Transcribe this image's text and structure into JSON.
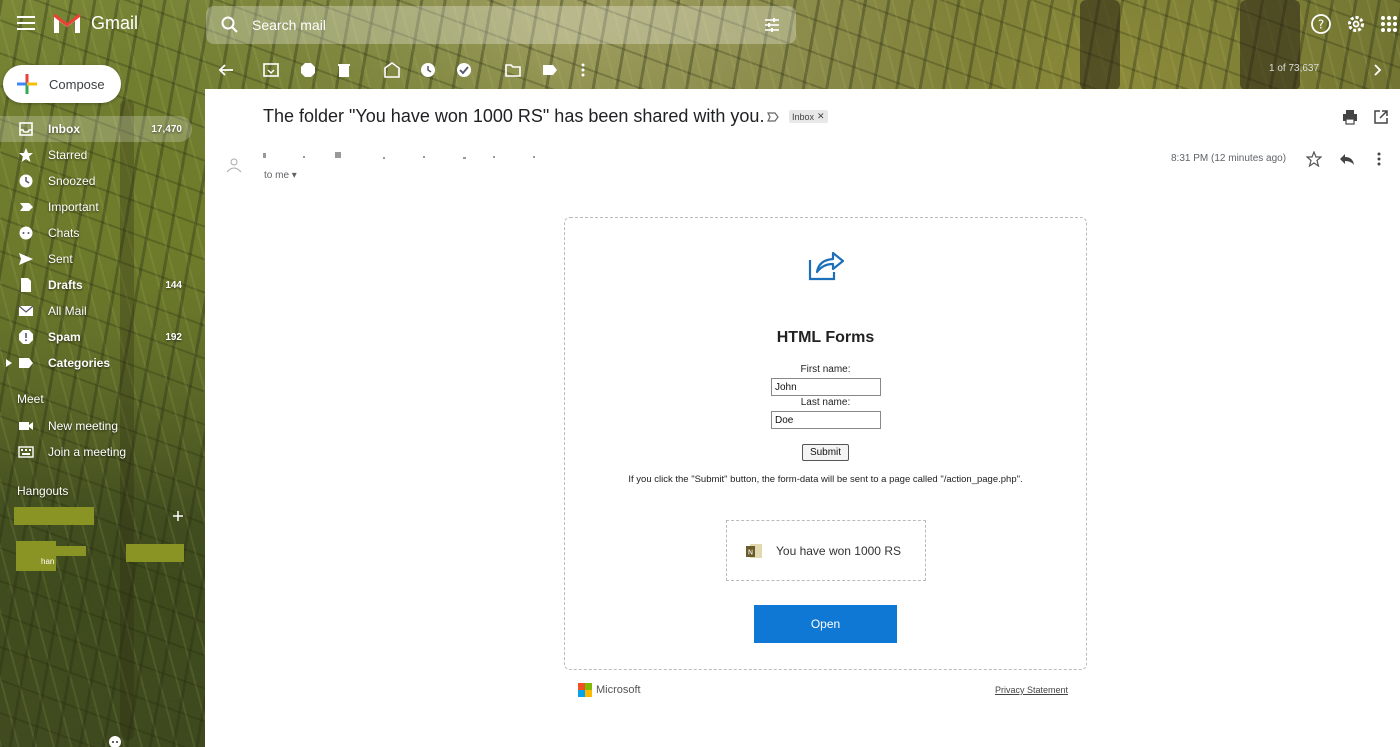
{
  "app": {
    "title": "Gmail"
  },
  "search": {
    "placeholder": "Search mail"
  },
  "compose": {
    "label": "Compose"
  },
  "sidebar": {
    "items": [
      {
        "label": "Inbox",
        "count": "17,470",
        "icon": "inbox-icon"
      },
      {
        "label": "Starred",
        "count": "",
        "icon": "star-icon"
      },
      {
        "label": "Snoozed",
        "count": "",
        "icon": "clock-icon"
      },
      {
        "label": "Important",
        "count": "",
        "icon": "important-icon"
      },
      {
        "label": "Chats",
        "count": "",
        "icon": "chat-icon"
      },
      {
        "label": "Sent",
        "count": "",
        "icon": "send-icon"
      },
      {
        "label": "Drafts",
        "count": "144",
        "icon": "draft-icon"
      },
      {
        "label": "All Mail",
        "count": "",
        "icon": "mail-icon"
      },
      {
        "label": "Spam",
        "count": "192",
        "icon": "spam-icon"
      },
      {
        "label": "Categories",
        "count": "",
        "icon": "label-icon"
      }
    ],
    "meet": {
      "title": "Meet",
      "items": [
        {
          "label": "New meeting",
          "icon": "video-icon"
        },
        {
          "label": "Join a meeting",
          "icon": "keyboard-icon"
        }
      ]
    },
    "hangouts": {
      "title": "Hangouts",
      "contact_fragment": "han"
    }
  },
  "toolbar": {
    "pager": "1 of 73,637"
  },
  "email": {
    "subject": "The folder \"You have won 1000 RS\" has been shared with you.",
    "label_chip": "Inbox",
    "recipient": "to me",
    "timestamp": "8:31 PM (12 minutes ago)"
  },
  "body": {
    "form_title": "HTML Forms",
    "first_name_label": "First name:",
    "first_name_value": "John",
    "last_name_label": "Last name:",
    "last_name_value": "Doe",
    "submit_label": "Submit",
    "note": "If you click the \"Submit\" button, the form-data will be sent to a page called \"/action_page.php\".",
    "file_name": "You have won 1000 RS",
    "open_label": "Open",
    "brand": "Microsoft",
    "privacy": "Privacy Statement"
  },
  "colors": {
    "accent": "#0f78d4",
    "gmail_red": "#ea4335"
  }
}
